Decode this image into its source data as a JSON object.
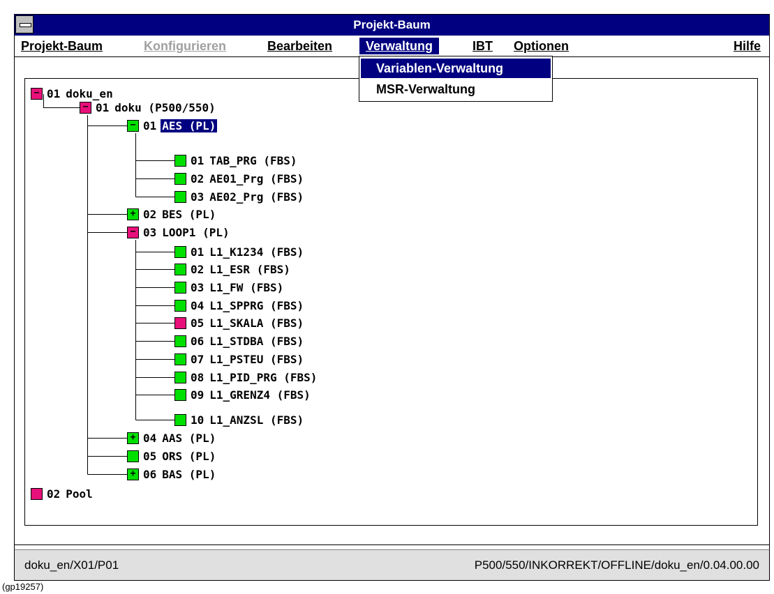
{
  "window": {
    "title": "Projekt-Baum"
  },
  "menu": {
    "items": [
      {
        "label": "Projekt-Baum"
      },
      {
        "label": "Konfigurieren"
      },
      {
        "label": "Bearbeiten"
      },
      {
        "label": "Verwaltung"
      },
      {
        "label": "IBT"
      },
      {
        "label": "Optionen"
      },
      {
        "label": "Hilfe"
      }
    ],
    "dropdown": [
      {
        "label": "Variablen-Verwaltung"
      },
      {
        "label": "MSR-Verwaltung"
      }
    ]
  },
  "colors": {
    "title_bg": "#000080",
    "node_collapsed_red": "#e8107a",
    "node_ok_green": "#00e000"
  },
  "tree": {
    "nodes": [
      {
        "num": "01",
        "label": "doku_en",
        "box": "minus",
        "color": "red"
      },
      {
        "num": "01",
        "label": "doku (P500/550)",
        "box": "minus",
        "color": "red"
      },
      {
        "num": "01",
        "label": "AES (PL)",
        "box": "minus",
        "color": "green",
        "selected": true
      },
      {
        "num": "01",
        "label": "TAB_PRG (FBS)",
        "box": "none",
        "color": "green"
      },
      {
        "num": "02",
        "label": "AE01_Prg (FBS)",
        "box": "none",
        "color": "green"
      },
      {
        "num": "03",
        "label": "AE02_Prg (FBS)",
        "box": "none",
        "color": "green"
      },
      {
        "num": "02",
        "label": "BES (PL)",
        "box": "plus",
        "color": "green"
      },
      {
        "num": "03",
        "label": "LOOP1 (PL)",
        "box": "minus",
        "color": "red"
      },
      {
        "num": "01",
        "label": "L1_K1234 (FBS)",
        "box": "none",
        "color": "green"
      },
      {
        "num": "02",
        "label": "L1_ESR (FBS)",
        "box": "none",
        "color": "green"
      },
      {
        "num": "03",
        "label": "L1_FW (FBS)",
        "box": "none",
        "color": "green"
      },
      {
        "num": "04",
        "label": "L1_SPPRG (FBS)",
        "box": "none",
        "color": "green"
      },
      {
        "num": "05",
        "label": "L1_SKALA (FBS)",
        "box": "none",
        "color": "red"
      },
      {
        "num": "06",
        "label": "L1_STDBA (FBS)",
        "box": "none",
        "color": "green"
      },
      {
        "num": "07",
        "label": "L1_PSTEU (FBS)",
        "box": "none",
        "color": "green"
      },
      {
        "num": "08",
        "label": "L1_PID_PRG (FBS)",
        "box": "none",
        "color": "green"
      },
      {
        "num": "09",
        "label": "L1_GRENZ4 (FBS)",
        "box": "none",
        "color": "green"
      },
      {
        "num": "10",
        "label": "L1_ANZSL (FBS)",
        "box": "none",
        "color": "green"
      },
      {
        "num": "04",
        "label": "AAS (PL)",
        "box": "plus",
        "color": "green"
      },
      {
        "num": "05",
        "label": "ORS (PL)",
        "box": "none",
        "color": "green"
      },
      {
        "num": "06",
        "label": "BAS (PL)",
        "box": "plus",
        "color": "green"
      },
      {
        "num": "02",
        "label": "Pool",
        "box": "none",
        "color": "red"
      }
    ]
  },
  "status": {
    "left": "doku_en/X01/P01",
    "right": "P500/550/INKORREKT/OFFLINE/doku_en/0.04.00.00"
  },
  "caption": "(gp19257)"
}
